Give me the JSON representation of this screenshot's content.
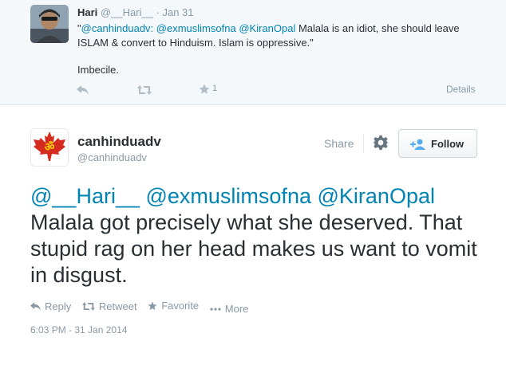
{
  "previous_tweet": {
    "name": "Hari",
    "handle": "@__Hari__",
    "separator": "·",
    "date": "Jan 31",
    "text_open_quote": "\"",
    "mentions": [
      "@canhinduadv:",
      "@exmuslimsofna",
      "@KiranOpal"
    ],
    "text_body": " Malala is an idiot, she should leave ISLAM & convert to Hinduism. Islam is oppressive.\"",
    "text_extra": "Imbecile.",
    "favorite_count": "1",
    "details_label": "Details"
  },
  "main_tweet": {
    "name": "canhinduadv",
    "handle": "@canhinduadv",
    "share_label": "Share",
    "follow_label": "Follow",
    "mentions": [
      "@__Hari__",
      "@exmuslimsofna",
      "@KiranOpal"
    ],
    "text_body": "Malala got precisely what she deserved. That stupid rag on her head makes us want to vomit in disgust.",
    "actions": {
      "reply": "Reply",
      "retweet": "Retweet",
      "favorite": "Favorite",
      "more": "More"
    },
    "timestamp": "6:03 PM - 31 Jan 2014"
  },
  "colors": {
    "link": "#0084b4",
    "muted": "#8899a6",
    "text": "#292f33",
    "flag_red": "#d52b1e"
  },
  "icons": [
    "reply-icon",
    "retweet-icon",
    "favorite-icon",
    "more-icon",
    "gear-icon",
    "add-user-icon"
  ]
}
